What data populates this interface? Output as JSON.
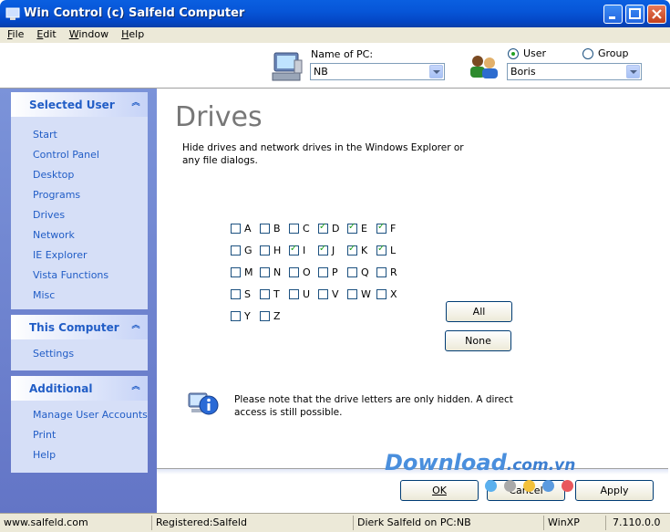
{
  "window": {
    "title": "Win Control (c) Salfeld Computer"
  },
  "menu": [
    "File",
    "Edit",
    "Window",
    "Help"
  ],
  "selector": {
    "pc_label": "Name of PC:",
    "pc_value": "NB",
    "user_radio": "User",
    "group_radio": "Group",
    "user_value": "Boris"
  },
  "sidebar": {
    "selected_user": {
      "title": "Selected User",
      "items": [
        "Start",
        "Control Panel",
        "Desktop",
        "Programs",
        "Drives",
        "Network",
        "IE Explorer",
        "Vista Functions",
        "Misc"
      ]
    },
    "this_computer": {
      "title": "This Computer",
      "items": [
        "Settings"
      ]
    },
    "additional": {
      "title": "Additional",
      "items": [
        "Manage User Accounts",
        "Print",
        "Help"
      ]
    }
  },
  "main": {
    "heading": "Drives",
    "description": "Hide drives and network drives in the Windows Explorer or any file dialogs.",
    "drives": [
      {
        "letter": "A",
        "checked": false
      },
      {
        "letter": "B",
        "checked": false
      },
      {
        "letter": "C",
        "checked": false
      },
      {
        "letter": "D",
        "checked": true
      },
      {
        "letter": "E",
        "checked": true
      },
      {
        "letter": "F",
        "checked": true
      },
      {
        "letter": "G",
        "checked": false
      },
      {
        "letter": "H",
        "checked": false
      },
      {
        "letter": "I",
        "checked": true
      },
      {
        "letter": "J",
        "checked": true
      },
      {
        "letter": "K",
        "checked": true
      },
      {
        "letter": "L",
        "checked": true
      },
      {
        "letter": "M",
        "checked": false
      },
      {
        "letter": "N",
        "checked": false
      },
      {
        "letter": "O",
        "checked": false
      },
      {
        "letter": "P",
        "checked": false
      },
      {
        "letter": "Q",
        "checked": false
      },
      {
        "letter": "R",
        "checked": false
      },
      {
        "letter": "S",
        "checked": false
      },
      {
        "letter": "T",
        "checked": false
      },
      {
        "letter": "U",
        "checked": false
      },
      {
        "letter": "V",
        "checked": false
      },
      {
        "letter": "W",
        "checked": false
      },
      {
        "letter": "X",
        "checked": false
      },
      {
        "letter": "Y",
        "checked": false
      },
      {
        "letter": "Z",
        "checked": false
      }
    ],
    "all_label": "All",
    "none_label": "None",
    "note": "Please note that the drive letters are only hidden. A direct access is still possible."
  },
  "buttons": {
    "ok": "OK",
    "cancel": "Cancel",
    "apply": "Apply"
  },
  "status": {
    "website": "www.salfeld.com",
    "registered": "Registered:Salfeld",
    "user_on_pc": "Dierk Salfeld on PC:NB",
    "os": "WinXP",
    "version": "7.110.0.0"
  },
  "watermark": {
    "main": "Download",
    "suffix": ".com.vn"
  },
  "colors": {
    "title_bar": "#0756d8",
    "sidebar_bg": "#6d84ce",
    "link": "#215dc6",
    "check": "#21a121"
  }
}
